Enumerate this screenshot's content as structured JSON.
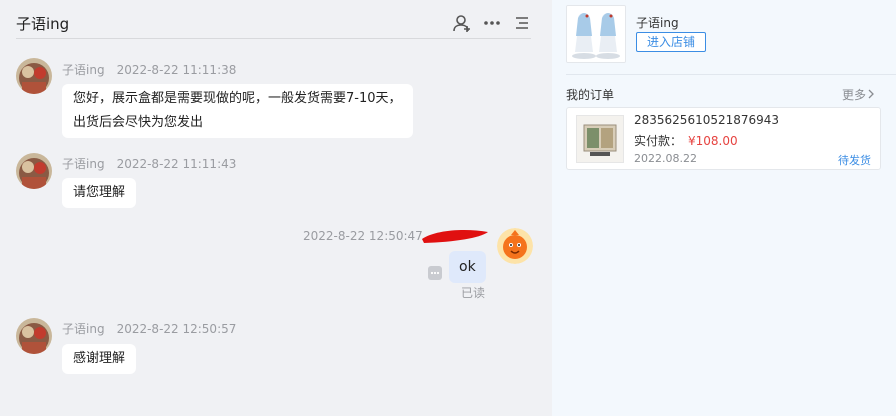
{
  "chat": {
    "title": "子语ing",
    "header_icons": [
      "add-user-icon",
      "more-icon",
      "list-icon"
    ],
    "messages": [
      {
        "sender": "子语ing",
        "time": "2022-8-22 11:11:38",
        "lines": [
          "您好，展示盒都是需要现做的呢，一般发货需要7-10天，",
          "出货后会尽快为您发出"
        ]
      },
      {
        "sender": "子语ing",
        "time": "2022-8-22 11:11:43",
        "lines": [
          "请您理解"
        ]
      },
      {
        "sender": "self",
        "time": "2022-8-22 12:50:47",
        "lines": [
          "ok"
        ],
        "status": "已读"
      },
      {
        "sender": "子语ing",
        "time": "2022-8-22 12:50:57",
        "lines": [
          "感谢理解"
        ]
      }
    ]
  },
  "shop": {
    "name": "子语ing",
    "enter_label": "进入店铺"
  },
  "orders": {
    "title": "我的订单",
    "more_label": "更多",
    "items": [
      {
        "id": "2835625610521876943",
        "paid_label": "实付款：",
        "price": "¥108.00",
        "date": "2022.08.22",
        "status": "待发货"
      }
    ]
  },
  "colors": {
    "accent": "#3b8de4",
    "price": "#e64340",
    "self_bubble": "#dfe9fb",
    "chat_bg": "#f0f1f4",
    "side_bg": "#f3f8fd",
    "redaction": "#e01010"
  }
}
